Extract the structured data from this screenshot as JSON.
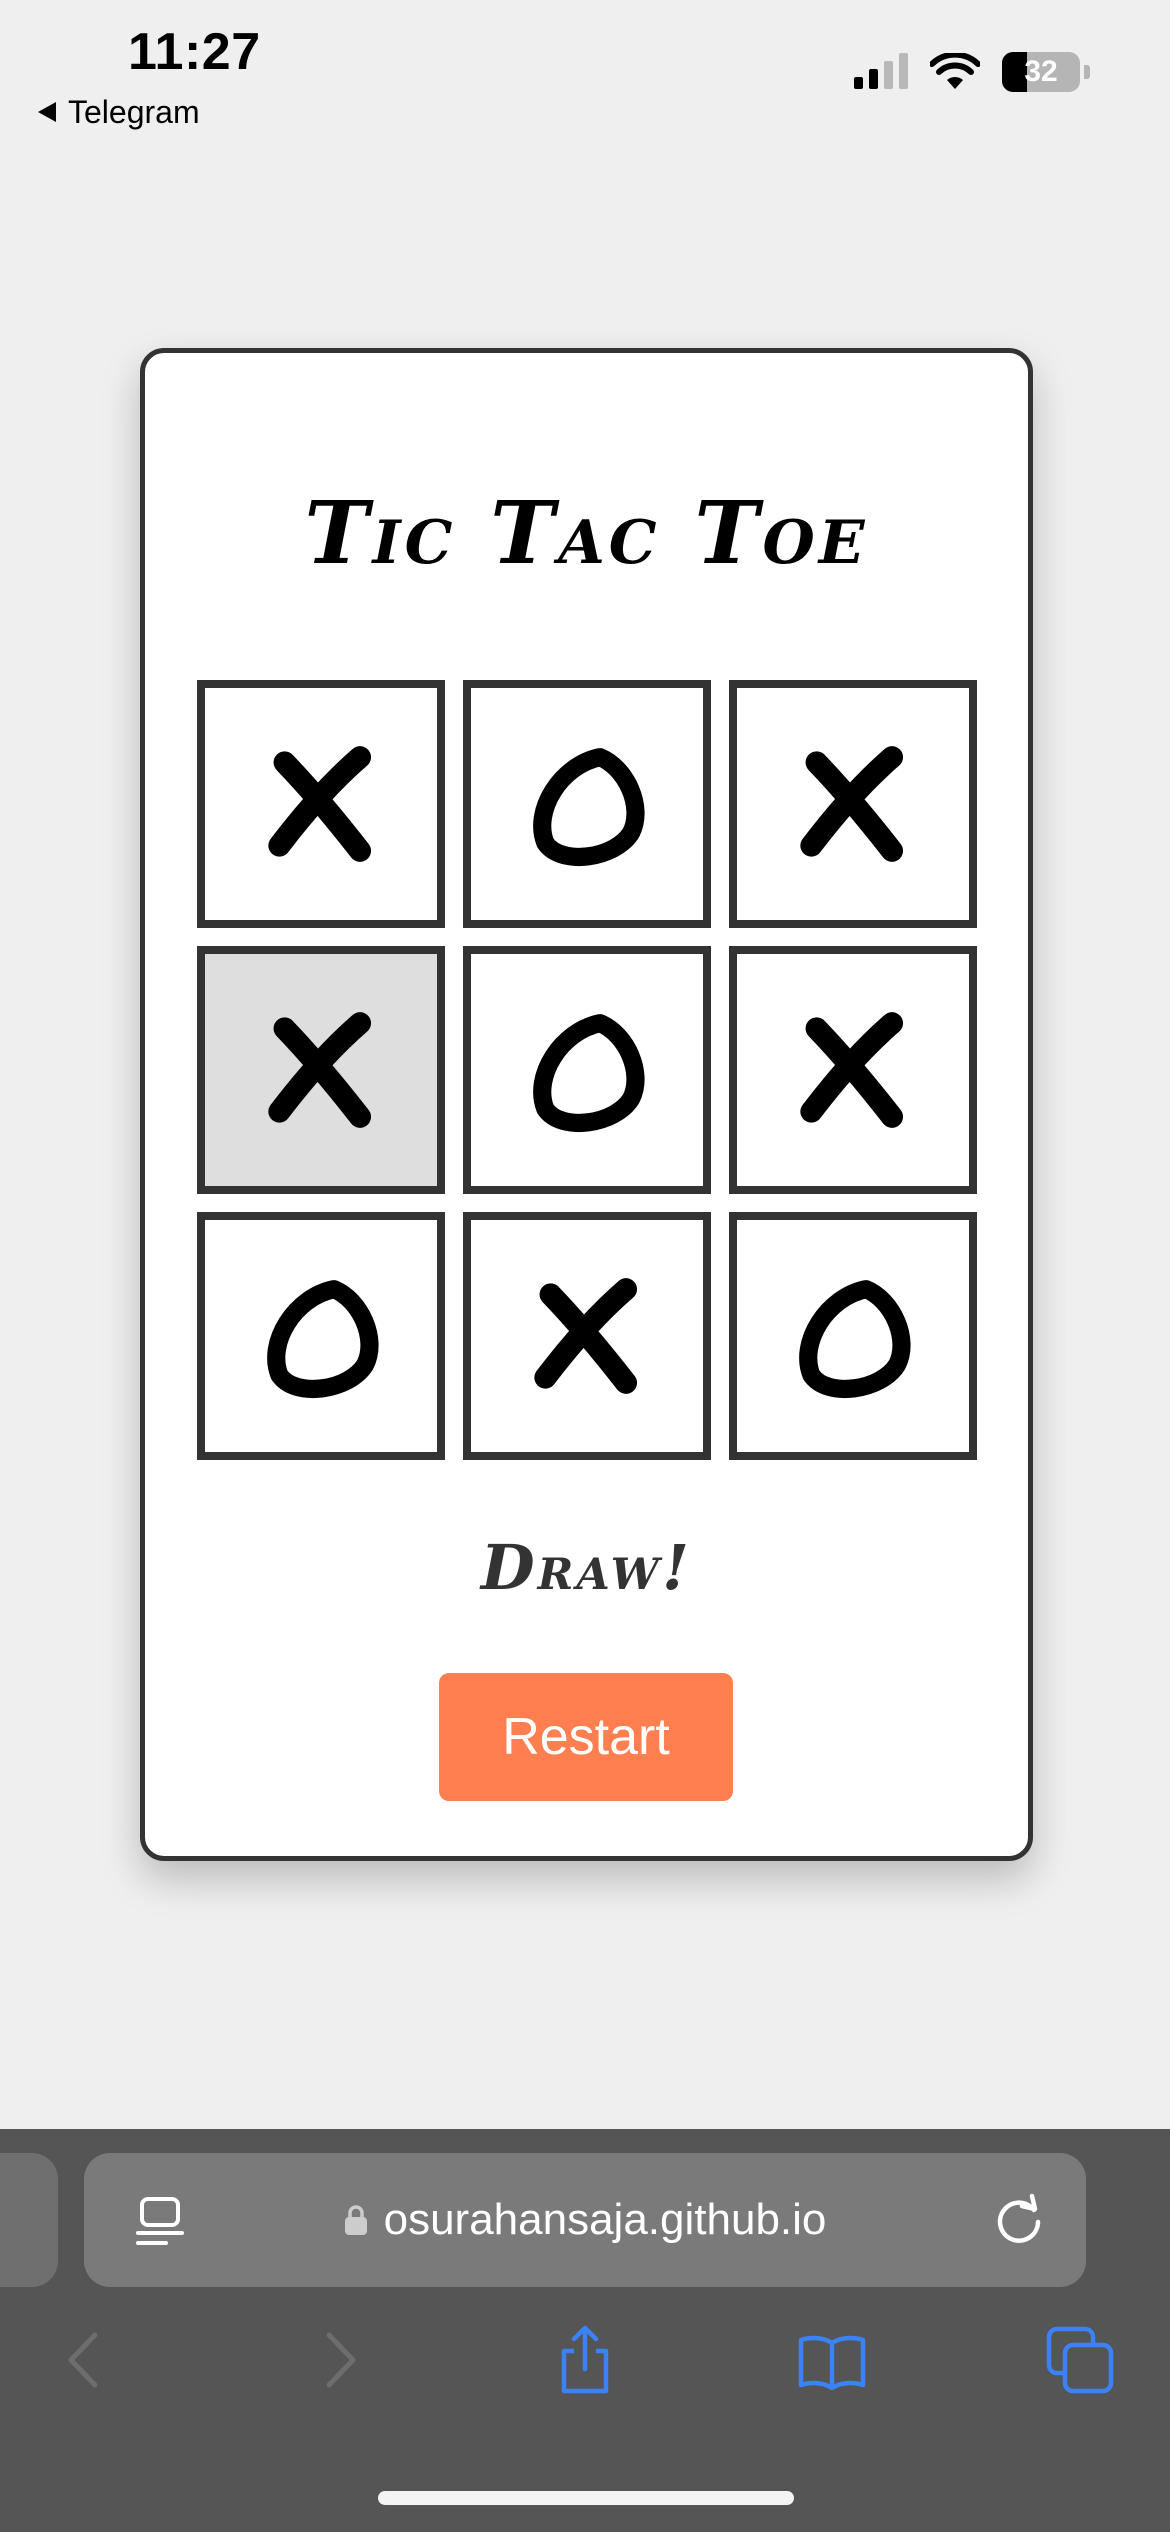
{
  "status_bar": {
    "time": "11:27",
    "back_label": "Telegram",
    "battery_level": "32",
    "icons": [
      "signal-icon",
      "wifi-icon",
      "battery-icon"
    ]
  },
  "game": {
    "title": "Tic Tac Toe",
    "board": [
      "X",
      "O",
      "X",
      "X",
      "O",
      "X",
      "O",
      "X",
      "O"
    ],
    "highlighted_cell": 3,
    "result": "Draw!",
    "restart_label": "Restart"
  },
  "browser": {
    "url": "osurahansaja.github.io",
    "icons": [
      "reader-icon",
      "lock-icon",
      "reload-icon",
      "back-icon",
      "forward-icon",
      "share-icon",
      "bookmarks-icon",
      "tabs-icon"
    ]
  },
  "colors": {
    "accent": "#ff7f50",
    "board_border": "#333333",
    "browser_bar": "#555555",
    "toolbar_icon_active": "#3b82f6",
    "toolbar_icon_disabled": "#6d6d6d"
  }
}
